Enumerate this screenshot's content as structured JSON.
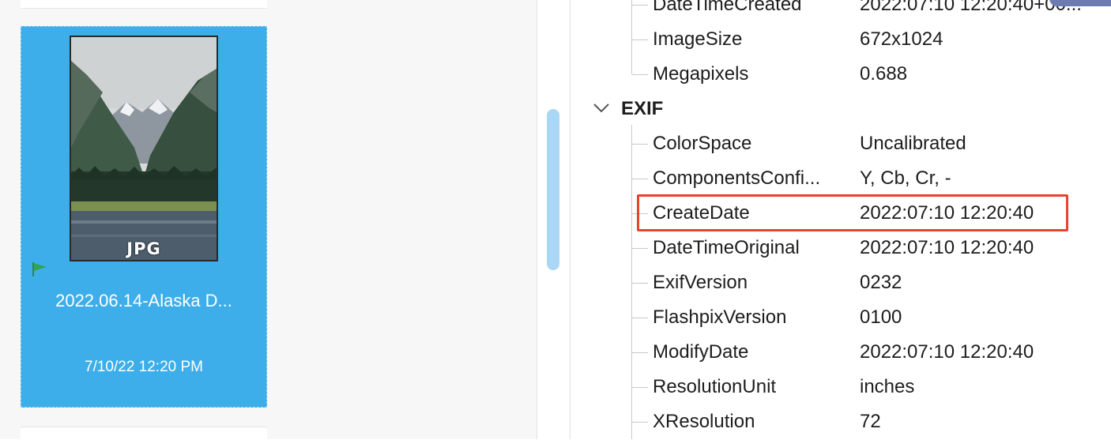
{
  "browser": {
    "selected_item": {
      "badge": "JPG",
      "name": "2022.06.14-Alaska D...",
      "date": "7/10/22 12:20 PM"
    }
  },
  "metadata": {
    "rows_top": [
      {
        "key": "DateTimeCreated",
        "value": "2022:07:10 12:20:40+00..."
      },
      {
        "key": "ImageSize",
        "value": "672x1024"
      },
      {
        "key": "Megapixels",
        "value": "0.688"
      }
    ],
    "exif_group": "EXIF",
    "exif_rows": [
      {
        "key": "ColorSpace",
        "value": "Uncalibrated"
      },
      {
        "key": "ComponentsConfi...",
        "value": "Y, Cb, Cr, -"
      },
      {
        "key": "CreateDate",
        "value": "2022:07:10 12:20:40"
      },
      {
        "key": "DateTimeOriginal",
        "value": "2022:07:10 12:20:40"
      },
      {
        "key": "ExifVersion",
        "value": "0232"
      },
      {
        "key": "FlashpixVersion",
        "value": "0100"
      },
      {
        "key": "ModifyDate",
        "value": "2022:07:10 12:20:40"
      },
      {
        "key": "ResolutionUnit",
        "value": "inches"
      },
      {
        "key": "XResolution",
        "value": "72"
      }
    ],
    "highlighted_key": "CreateDate"
  },
  "colors": {
    "selection": "#3daee9",
    "highlight_box": "#e8432e",
    "scroll_thumb": "#a9d7f5"
  },
  "icons": {
    "flag": "flag-icon",
    "expand": "chevron-down-icon"
  }
}
